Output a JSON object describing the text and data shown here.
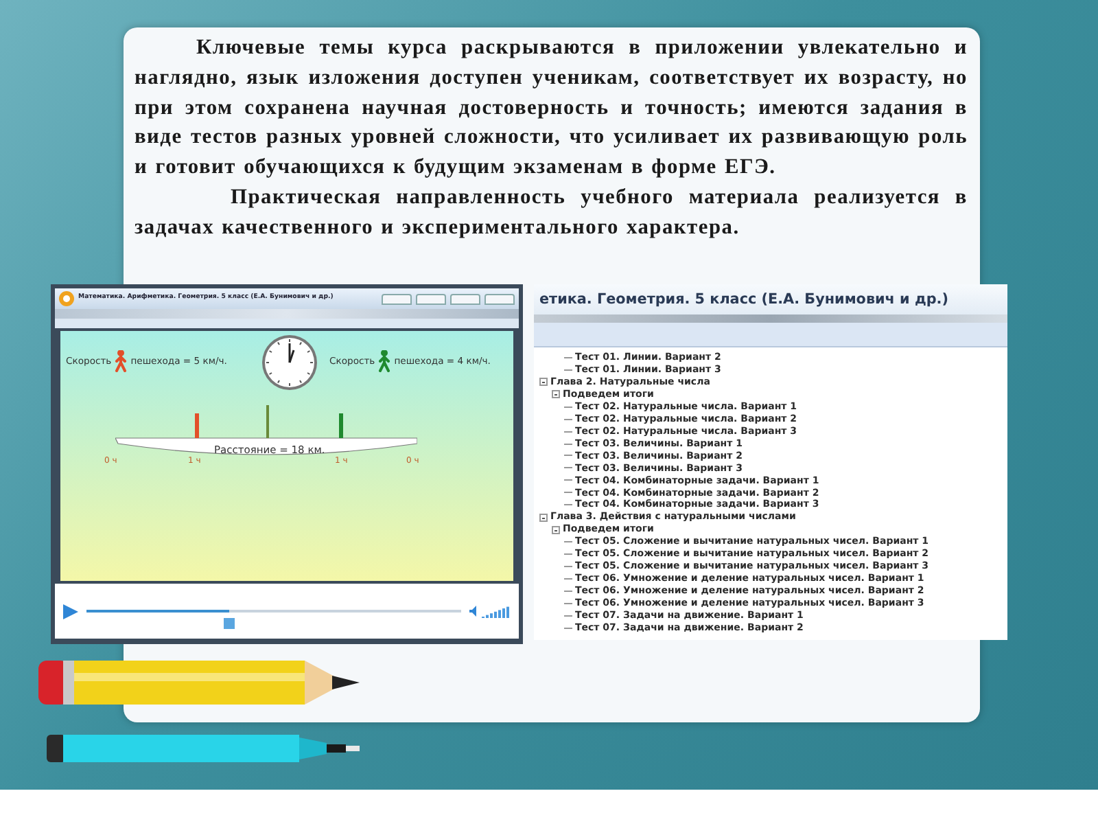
{
  "slide": {
    "paragraphs": [
      "Ключевые темы курса раскрываются в приложении увлекательно и наглядно, язык изложения доступен ученикам, соответствует их возрасту, но при этом сохранена научная достоверность и точность; имеются задания в виде тестов разных уровней сложности, что усиливает их развивающую роль и готовит обучающихся к будущим экзаменам в форме ЕГЭ.",
      "Практическая направленность учебного материала реализуется в задачах качественного и экспериментального характера."
    ]
  },
  "video_window": {
    "title": "Математика. Арифметика. Геометрия. 5 класс (Е.А. Бунимович и др.)",
    "animation": {
      "speeds": [
        {
          "prefix": "Скорость",
          "suffix": "пешехода = 5 км/ч.",
          "color": "#e2502a"
        },
        {
          "prefix": "Скорость",
          "suffix": "пешехода = 4 км/ч.",
          "color": "#1f8a2e"
        }
      ],
      "distance": "Расстояние = 18 км.",
      "ticks": [
        "0 ч",
        "1 ч",
        "1 ч",
        "0 ч"
      ]
    },
    "player": {
      "level": 0.38
    }
  },
  "test_window": {
    "title": "етика. Геометрия. 5 класс (Е.А. Бунимович и др.)",
    "tree": [
      {
        "children": [
          {
            "children": [
              {
                "label": "Тест 01. Линии. Вариант 2"
              },
              {
                "label": "Тест 01. Линии. Вариант 3"
              }
            ]
          }
        ]
      },
      {
        "label": "Глава 2. Натуральные числа",
        "expanded": true,
        "children": [
          {
            "label": "Подведем итоги",
            "expanded": true,
            "children": [
              {
                "label": "Тест 02. Натуральные числа. Вариант 1"
              },
              {
                "label": "Тест 02. Натуральные числа. Вариант 2"
              },
              {
                "label": "Тест 02. Натуральные числа. Вариант 3"
              },
              {
                "label": "Тест 03. Величины. Вариант 1"
              },
              {
                "label": "Тест 03. Величины. Вариант 2"
              },
              {
                "label": "Тест 03. Величины. Вариант 3"
              },
              {
                "label": "Тест 04. Комбинаторные задачи. Вариант 1"
              },
              {
                "label": "Тест 04. Комбинаторные задачи. Вариант 2"
              },
              {
                "label": "Тест 04. Комбинаторные задачи. Вариант 3"
              }
            ]
          }
        ]
      },
      {
        "label": "Глава 3. Действия с натуральными числами",
        "expanded": true,
        "children": [
          {
            "label": "Подведем итоги",
            "expanded": true,
            "children": [
              {
                "label": "Тест 05. Сложение и вычитание натуральных чисел. Вариант 1"
              },
              {
                "label": "Тест 05. Сложение и вычитание натуральных чисел. Вариант 2"
              },
              {
                "label": "Тест 05. Сложение и вычитание натуральных чисел. Вариант 3"
              },
              {
                "label": "Тест 06. Умножение и деление натуральных чисел. Вариант 1"
              },
              {
                "label": "Тест 06. Умножение и деление натуральных чисел. Вариант 2"
              },
              {
                "label": "Тест 06. Умножение и деление натуральных чисел. Вариант 3"
              },
              {
                "label": "Тест 07. Задачи на движение. Вариант 1"
              },
              {
                "label": "Тест 07. Задачи на движение. Вариант 2"
              }
            ]
          }
        ]
      }
    ]
  }
}
